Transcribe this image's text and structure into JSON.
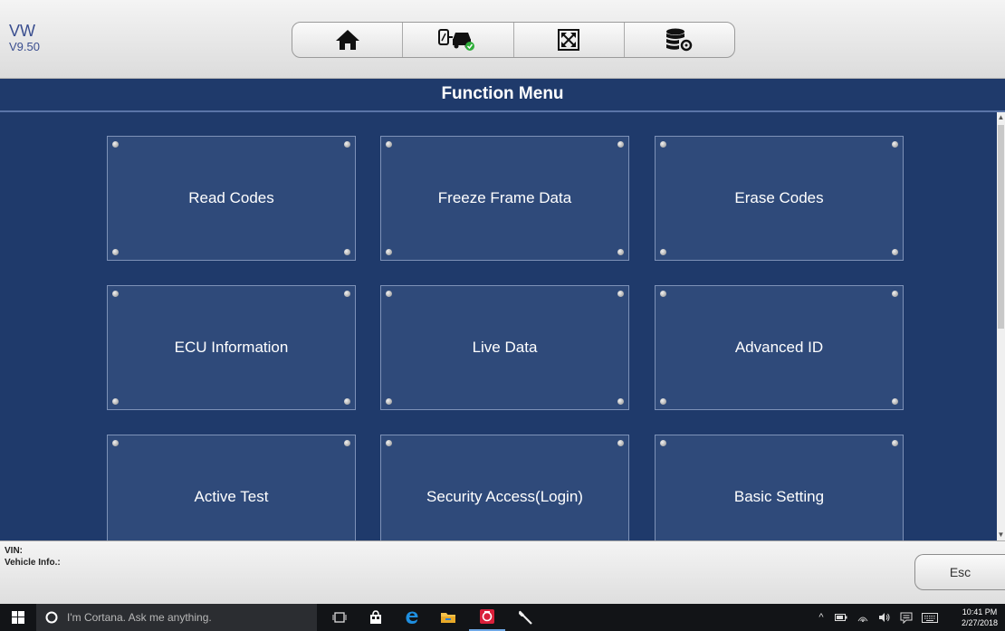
{
  "header": {
    "make": "VW",
    "version": "V9.50",
    "toolbar": [
      {
        "icon": "home-icon"
      },
      {
        "icon": "vehicle-connect-icon"
      },
      {
        "icon": "fullscreen-icon"
      },
      {
        "icon": "database-settings-icon"
      }
    ]
  },
  "title": "Function Menu",
  "functions": [
    {
      "label": "Read Codes"
    },
    {
      "label": "Freeze Frame Data"
    },
    {
      "label": "Erase Codes"
    },
    {
      "label": "ECU Information"
    },
    {
      "label": "Live Data"
    },
    {
      "label": "Advanced ID"
    },
    {
      "label": "Active Test"
    },
    {
      "label": "Security Access(Login)"
    },
    {
      "label": "Basic Setting"
    }
  ],
  "footer": {
    "vin_label": "VIN:",
    "vehicle_info_label": "Vehicle Info.:",
    "esc_label": "Esc"
  },
  "taskbar": {
    "search_placeholder": "I'm Cortana. Ask me anything.",
    "time": "10:41 PM",
    "date": "2/27/2018"
  },
  "colors": {
    "title_bar": "#1f3a6b",
    "tile": "#2f4a7a",
    "brand_text": "#3a4e8f",
    "taskbar": "#121417"
  }
}
